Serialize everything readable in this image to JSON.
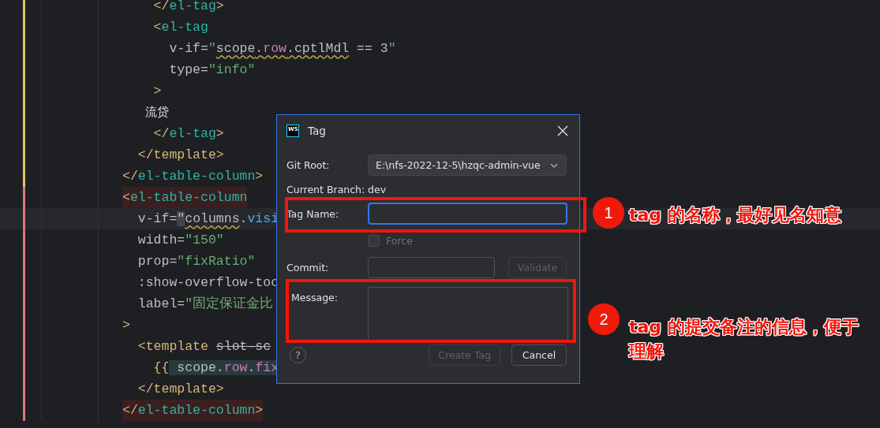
{
  "editor": {
    "lines": [
      {
        "color": "#e0c36a",
        "flagged": false,
        "current": false,
        "tokens": [
          {
            "kind": "bracket",
            "text": "    </"
          },
          {
            "kind": "tag",
            "text": "el-tag"
          },
          {
            "kind": "bracket",
            "text": ">"
          }
        ]
      },
      {
        "color": "#e0c36a",
        "flagged": false,
        "current": false,
        "tokens": [
          {
            "kind": "bracket",
            "text": "    <"
          },
          {
            "kind": "tag",
            "text": "el-tag"
          }
        ]
      },
      {
        "color": "#e0c36a",
        "flagged": false,
        "current": false,
        "tokens": [
          {
            "kind": "attr",
            "text": "      v-if"
          },
          {
            "kind": "eq",
            "text": "="
          },
          {
            "kind": "str",
            "text": "\""
          },
          {
            "kind": "squiggle",
            "tokens": [
              {
                "kind": "var",
                "text": "scope"
              },
              {
                "kind": "var",
                "text": "."
              },
              {
                "kind": "field",
                "text": "row"
              },
              {
                "kind": "var",
                "text": ".cptlMdl"
              }
            ]
          },
          {
            "kind": "var",
            "text": " == 3"
          },
          {
            "kind": "str",
            "text": "\""
          }
        ]
      },
      {
        "color": "#e0c36a",
        "flagged": false,
        "current": false,
        "tokens": [
          {
            "kind": "attr",
            "text": "      type"
          },
          {
            "kind": "eq",
            "text": "="
          },
          {
            "kind": "str",
            "text": "\"info\""
          }
        ]
      },
      {
        "color": "#e0c36a",
        "flagged": false,
        "current": false,
        "tokens": [
          {
            "kind": "bracket",
            "text": "    >"
          }
        ]
      },
      {
        "color": "#e0c36a",
        "flagged": false,
        "current": false,
        "tokens": [
          {
            "kind": "text",
            "text": "      流贷"
          }
        ]
      },
      {
        "color": "#e0c36a",
        "flagged": false,
        "current": false,
        "tokens": [
          {
            "kind": "bracket",
            "text": "    </"
          },
          {
            "kind": "tag",
            "text": "el-tag"
          },
          {
            "kind": "bracket",
            "text": ">"
          }
        ]
      },
      {
        "color": "#e0c36a",
        "flagged": false,
        "current": false,
        "tokens": [
          {
            "kind": "bracket",
            "text": "  </template>"
          }
        ]
      },
      {
        "color": "#e0c36a",
        "flagged": false,
        "current": false,
        "tokens": [
          {
            "kind": "bracket",
            "text": "</"
          },
          {
            "kind": "tag",
            "text": "el-table-column"
          },
          {
            "kind": "bracket",
            "text": ">"
          }
        ]
      },
      {
        "color": "#d97a7a",
        "flagged": true,
        "current": false,
        "tokens": [
          {
            "kind": "bracket",
            "text": "<"
          },
          {
            "kind": "tag",
            "text": "el-table-column"
          }
        ]
      },
      {
        "color": "#d97a7a",
        "flagged": false,
        "current": true,
        "tokens": [
          {
            "kind": "attr",
            "text": "  v-if"
          },
          {
            "kind": "eq",
            "text": "="
          },
          {
            "kind": "caret",
            "text": "\""
          },
          {
            "kind": "squiggle",
            "tokens": [
              {
                "kind": "var",
                "text": "columns"
              }
            ]
          },
          {
            "kind": "var",
            "text": "."
          },
          {
            "kind": "call",
            "text": "visi"
          }
        ]
      },
      {
        "color": "#d97a7a",
        "flagged": false,
        "current": false,
        "tokens": [
          {
            "kind": "attr",
            "text": "  width"
          },
          {
            "kind": "eq",
            "text": "="
          },
          {
            "kind": "str",
            "text": "\"150\""
          }
        ]
      },
      {
        "color": "#d97a7a",
        "flagged": false,
        "current": false,
        "tokens": [
          {
            "kind": "attr",
            "text": "  prop"
          },
          {
            "kind": "eq",
            "text": "="
          },
          {
            "kind": "str",
            "text": "\"fixRatio\""
          }
        ]
      },
      {
        "color": "#d97a7a",
        "flagged": false,
        "current": false,
        "tokens": [
          {
            "kind": "attr",
            "text": "  :show-overflow-too"
          }
        ]
      },
      {
        "color": "#d97a7a",
        "flagged": false,
        "current": false,
        "tokens": [
          {
            "kind": "attr",
            "text": "  label"
          },
          {
            "kind": "eq",
            "text": "="
          },
          {
            "kind": "str",
            "text": "\"固定保证金比"
          }
        ]
      },
      {
        "color": "#d97a7a",
        "flagged": false,
        "current": false,
        "tokens": [
          {
            "kind": "bracket",
            "text": ">"
          }
        ]
      },
      {
        "color": "#d97a7a",
        "flagged": false,
        "current": false,
        "tokens": [
          {
            "kind": "bracket",
            "text": "  <template "
          },
          {
            "kind": "struck",
            "text": "slot-sc"
          }
        ]
      },
      {
        "color": "#d97a7a",
        "flagged": false,
        "current": false,
        "tokens": [
          {
            "kind": "bracket",
            "text": "    {{"
          },
          {
            "kind": "marked",
            "tokens": [
              {
                "kind": "var",
                "text": " scope"
              },
              {
                "kind": "var",
                "text": "."
              },
              {
                "kind": "field",
                "text": "row"
              },
              {
                "kind": "var",
                "text": "."
              },
              {
                "kind": "field",
                "text": "fix"
              }
            ]
          }
        ]
      },
      {
        "color": "#d97a7a",
        "flagged": false,
        "current": false,
        "tokens": [
          {
            "kind": "bracket",
            "text": "  </template>"
          }
        ]
      },
      {
        "color": "#d97a7a",
        "flagged": true,
        "current": false,
        "tokens": [
          {
            "kind": "bracket",
            "text": "</"
          },
          {
            "kind": "tag",
            "text": "el-table-column"
          },
          {
            "kind": "bracket",
            "text": ">"
          }
        ]
      }
    ]
  },
  "dialog": {
    "icon_text": "WS",
    "title": "Tag",
    "git_root": {
      "label": "Git Root:",
      "value": "E:\\nfs-2022-12-5\\hzqc-admin-vue"
    },
    "current_branch": {
      "label": "Current Branch:",
      "value": "dev"
    },
    "tag_name": {
      "label": "Tag Name:",
      "focused": true
    },
    "force": {
      "label": "Force",
      "checked": false,
      "disabled": true
    },
    "commit": {
      "label": "Commit:"
    },
    "validate_button": {
      "label": "Validate",
      "disabled": true
    },
    "message": {
      "label": "Message:"
    },
    "help": "?",
    "buttons": [
      {
        "label": "Create Tag",
        "disabled": true
      },
      {
        "label": "Cancel",
        "disabled": false
      }
    ]
  },
  "annotations": [
    {
      "number": "1",
      "text": "tag 的名称，最好见名知意"
    },
    {
      "number": "2",
      "text": "tag 的提交备注的信息，便于理解"
    }
  ]
}
